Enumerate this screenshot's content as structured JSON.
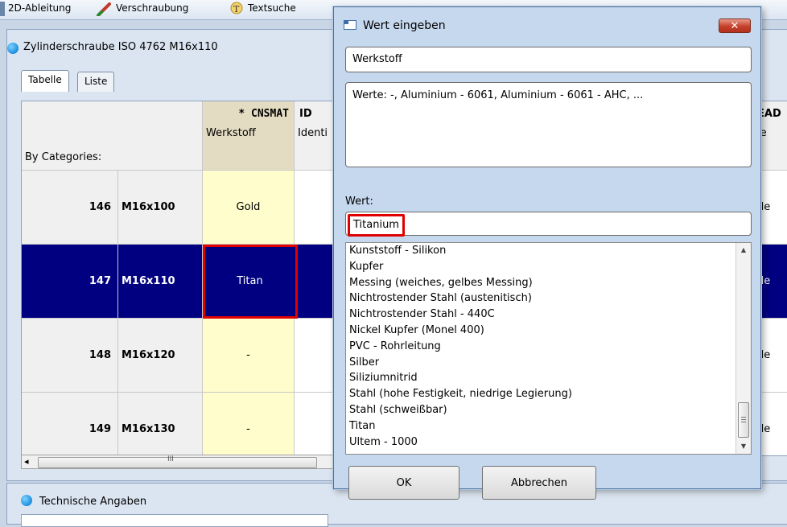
{
  "toolbar": {
    "items": [
      {
        "label": "2D-Ableitung",
        "icon": "drawing-icon"
      },
      {
        "label": "Verschraubung",
        "icon": "screw-icon"
      },
      {
        "label": "Textsuche",
        "icon": "text-search-icon"
      }
    ]
  },
  "main_panel": {
    "title": "Zylinderschraube ISO 4762 M16x110",
    "tabs": [
      "Tabelle",
      "Liste"
    ],
    "by_categories": "By Categories:",
    "columns": [
      {
        "code": "* CNSMAT",
        "label": "Werkstoff"
      },
      {
        "code": "ID",
        "label": "Identi"
      },
      {
        "code": "EAD",
        "label": "le"
      }
    ],
    "rows": [
      {
        "num": "146",
        "name": "M16x100",
        "material": "Gold",
        "right": "de"
      },
      {
        "num": "147",
        "name": "M16x110",
        "material": "Titan",
        "right": "de"
      },
      {
        "num": "148",
        "name": "M16x120",
        "material": "-",
        "right": "de"
      },
      {
        "num": "149",
        "name": "M16x130",
        "material": "-",
        "right": "de"
      }
    ],
    "scroll_left": "◂",
    "scroll_grip": "III"
  },
  "bottom_panel": {
    "title": "Technische Angaben"
  },
  "dialog": {
    "title": "Wert eingeben",
    "close_label": "✕",
    "field_name": "Werkstoff",
    "values_text": "Werte: -, Aluminium - 6061, Aluminium - 6061 - AHC, ...",
    "value_label": "Wert:",
    "value_input": "Titanium",
    "list_items": [
      "Kunststoff - Silikon",
      "Kupfer",
      "Messing (weiches, gelbes Messing)",
      "Nichtrostender Stahl (austenitisch)",
      "Nichtrostender Stahl - 440C",
      "Nickel Kupfer (Monel 400)",
      "PVC - Rohrleitung",
      "Silber",
      "Siliziumnitrid",
      "Stahl (hohe Festigkeit, niedrige Legierung)",
      "Stahl (schweißbar)",
      "Titan",
      "Ultem - 1000"
    ],
    "ok_label": "OK",
    "cancel_label": "Abbrechen"
  },
  "colors": {
    "selection": "#000080",
    "highlight": "#e00000",
    "cell_yellow": "#fffdcc"
  }
}
